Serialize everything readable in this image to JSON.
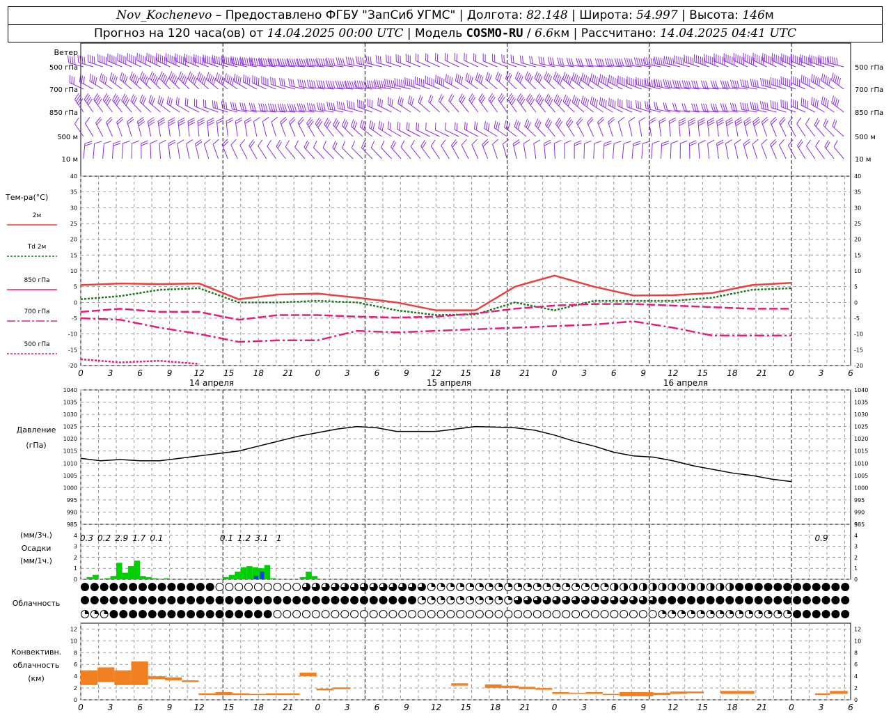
{
  "header": {
    "station": "Nov_Kochenevo",
    "provider": "Предоставлено ФГБУ \"ЗапСиб УГМС\"",
    "lon_label": "Долгота:",
    "lon_value": "82.148",
    "lat_label": "Широта:",
    "lat_value": "54.997",
    "alt_label": "Высота:",
    "alt_value": "146",
    "alt_unit": "м",
    "forecast_prefix": "Прогноз на 120 часа(ов) от",
    "forecast_start": "14.04.2025 00:00 UTC",
    "model_label": "Модель",
    "model_name": "COSMO-RU",
    "model_res_value": "6.6",
    "model_res_unit": "км",
    "calc_label": "Рассчитано:",
    "calc_time": "14.04.2025 04:41 UTC"
  },
  "colors": {
    "wind": "#8a2be2",
    "t2m": "#e84040",
    "td2m": "#1e7a1e",
    "t850": "#e0207a",
    "precip": "#00d000",
    "precip_other": "#1040e0",
    "conv": "#f08020",
    "grid": "#999999"
  },
  "x_ticks": [
    "0",
    "3",
    "6",
    "9",
    "12",
    "15",
    "18",
    "21",
    "0",
    "3",
    "6",
    "9",
    "12",
    "15",
    "18",
    "21",
    "0",
    "3",
    "6",
    "9",
    "12",
    "15",
    "18",
    "21",
    "0",
    "3",
    "6"
  ],
  "day_labels": [
    "14 апреля",
    "15 апреля",
    "16 апреля"
  ],
  "wind_panel": {
    "title": "Ветер",
    "levels": [
      "500 гПа",
      "700 гПа",
      "850 гПа",
      "500 м",
      "10 м"
    ]
  },
  "temp_panel": {
    "title": "Тем-ра(°C)",
    "legend": [
      {
        "label": "2м",
        "prefix": ""
      },
      {
        "label": "2м",
        "prefix": "Td"
      },
      {
        "label": "гПа",
        "prefix": "850"
      },
      {
        "label": "гПа",
        "prefix": "700"
      },
      {
        "label": "гПа",
        "prefix": "500"
      }
    ],
    "y_ticks": [
      "40",
      "35",
      "30",
      "25",
      "20",
      "15",
      "10",
      "5",
      "0",
      "-5",
      "-10",
      "-15",
      "-20"
    ]
  },
  "pressure_panel": {
    "title": "Давление",
    "unit": "(гПа)",
    "y_ticks": [
      "1040",
      "1035",
      "1030",
      "1025",
      "1020",
      "1015",
      "1010",
      "1005",
      "1000",
      "995",
      "990",
      "985"
    ]
  },
  "precip_panel": {
    "unit3": "(мм/3ч.)",
    "title": "Осадки",
    "unit1": "(мм/1ч.)",
    "y_ticks": [
      "5",
      "4",
      "3",
      "2",
      "1",
      "0"
    ],
    "totals": [
      {
        "hour": 1,
        "text": "0.3"
      },
      {
        "hour": 4,
        "text": "0.2"
      },
      {
        "hour": 7,
        "text": "2.9"
      },
      {
        "hour": 10,
        "text": "1.7"
      },
      {
        "hour": 13,
        "text": "0.1"
      },
      {
        "hour": 25,
        "text": "0.1"
      },
      {
        "hour": 28,
        "text": "1.2"
      },
      {
        "hour": 31,
        "text": "3.1"
      },
      {
        "hour": 34,
        "text": "1"
      },
      {
        "hour": 127,
        "text": "0.9"
      }
    ]
  },
  "cloud_panel": {
    "title": "Облачность"
  },
  "conv_panel": {
    "title1": "Конвективн.",
    "title2": "облачность",
    "unit": "(км)",
    "y_ticks": [
      "12",
      "10",
      "8",
      "6",
      "4",
      "2",
      "0"
    ]
  },
  "chart_data": {
    "type": "line",
    "x_hours_from_start": [
      0,
      6,
      12,
      18,
      24,
      30,
      36,
      42,
      48,
      54,
      60,
      66,
      72,
      78,
      84,
      90,
      96,
      102,
      108,
      114,
      120
    ],
    "series": [
      {
        "name": "2м",
        "values": [
          5.5,
          6,
          5.8,
          6,
          1,
          2.5,
          2.8,
          1.5,
          0,
          -2.5,
          -2.5,
          5,
          8.5,
          5,
          2.2,
          2.3,
          3,
          5.5,
          6.2
        ]
      },
      {
        "name": "Td 2м",
        "values": [
          1,
          2,
          4,
          4.5,
          0,
          0,
          0.5,
          0,
          -2.5,
          -4,
          -3.8,
          0,
          -2.5,
          0.5,
          0.5,
          0.5,
          1.5,
          4,
          4.5
        ]
      },
      {
        "name": "850 гПа",
        "values": [
          -3,
          -2,
          -3,
          -3,
          -5.5,
          -4,
          -4,
          -4.5,
          -4.8,
          -4.5,
          -3.5,
          -2,
          -1,
          -0.5,
          -0.5,
          -1,
          -1.5,
          -2,
          -2
        ]
      },
      {
        "name": "700 гПа",
        "values": [
          -5,
          -5.5,
          -8,
          -10,
          -12.5,
          -12,
          -12,
          -9,
          -9.5,
          -9,
          -8.5,
          -8,
          -7.5,
          -7,
          -6,
          -8,
          -10.5,
          -10.5,
          -10.5
        ]
      },
      {
        "name": "500 гПа",
        "values": [
          -18,
          -19,
          -18.5,
          -19.5
        ]
      }
    ],
    "pressure": {
      "name": "Давление",
      "unit": "гПа",
      "values": [
        1012,
        1011,
        1011.5,
        1011,
        1011,
        1012,
        1013,
        1014,
        1015,
        1017,
        1019,
        1021,
        1022.5,
        1024,
        1025,
        1024.5,
        1023,
        1023,
        1023,
        1024,
        1025,
        1024.8,
        1024.5,
        1023.5,
        1021.5,
        1019,
        1017,
        1014.5,
        1013,
        1012.5,
        1011,
        1009,
        1007.5,
        1006,
        1005,
        1003.5,
        1002.5
      ]
    },
    "precip_1h": [
      0,
      0.2,
      0.4,
      0,
      0.1,
      0.3,
      1.5,
      0.6,
      1.2,
      1.7,
      0.3,
      0.2,
      0.1,
      0.05,
      0.1,
      0,
      0,
      0,
      0,
      0,
      0,
      0,
      0,
      0.05,
      0.2,
      0.4,
      0.7,
      1.1,
      1.2,
      1.1,
      1.0,
      1.3,
      0.1,
      0,
      0,
      0,
      0,
      0.2,
      0.7,
      0.3
    ],
    "precip_1h_other": [
      0,
      0,
      0,
      0,
      0,
      0,
      0,
      0,
      0,
      0,
      0,
      0,
      0,
      0,
      0,
      0,
      0,
      0,
      0,
      0,
      0,
      0,
      0,
      0,
      0,
      0,
      0,
      0,
      0,
      0.3,
      0.7,
      0,
      0,
      0,
      0,
      0,
      0,
      0,
      0,
      0
    ],
    "convective_km": [
      [
        0,
        1,
        2.5,
        5
      ],
      [
        1,
        2,
        3,
        5.5
      ],
      [
        2,
        3,
        2.5,
        5
      ],
      [
        3,
        4,
        2.5,
        6.5
      ],
      [
        4,
        5,
        3.5,
        4
      ],
      [
        5,
        6,
        3.3,
        3.8
      ],
      [
        6,
        7,
        3,
        3.3
      ],
      [
        7,
        8,
        0.8,
        1.1
      ],
      [
        8,
        9,
        0.8,
        1.3
      ],
      [
        9,
        10,
        0.8,
        1.1
      ],
      [
        10,
        11,
        0.8,
        1.0
      ],
      [
        11,
        12,
        0.8,
        1.1
      ],
      [
        12,
        13,
        0.8,
        1.1
      ],
      [
        13,
        14,
        4,
        4.6
      ],
      [
        14,
        15,
        1.6,
        1.9
      ],
      [
        15,
        16,
        1.8,
        2.1
      ],
      [
        22,
        23,
        2.4,
        2.8
      ],
      [
        24,
        25,
        2.0,
        2.6
      ],
      [
        25,
        26,
        2.0,
        2.4
      ],
      [
        26,
        27,
        1.8,
        2.2
      ],
      [
        27,
        28,
        1.7,
        2.0
      ],
      [
        28,
        29,
        1.0,
        1.3
      ],
      [
        29,
        30,
        1.0,
        1.2
      ],
      [
        30,
        31,
        1.0,
        1.3
      ],
      [
        31,
        32,
        0.8,
        1.0
      ],
      [
        32,
        33,
        0.6,
        1.3
      ],
      [
        33,
        34,
        0.6,
        1.3
      ],
      [
        34,
        35,
        0.8,
        1.2
      ],
      [
        35,
        36,
        1.0,
        1.4
      ],
      [
        36,
        37,
        1.1,
        1.4
      ],
      [
        38,
        39,
        1.0,
        1.5
      ],
      [
        39,
        40,
        1.0,
        1.5
      ]
    ],
    "cloud_rows": 3
  }
}
